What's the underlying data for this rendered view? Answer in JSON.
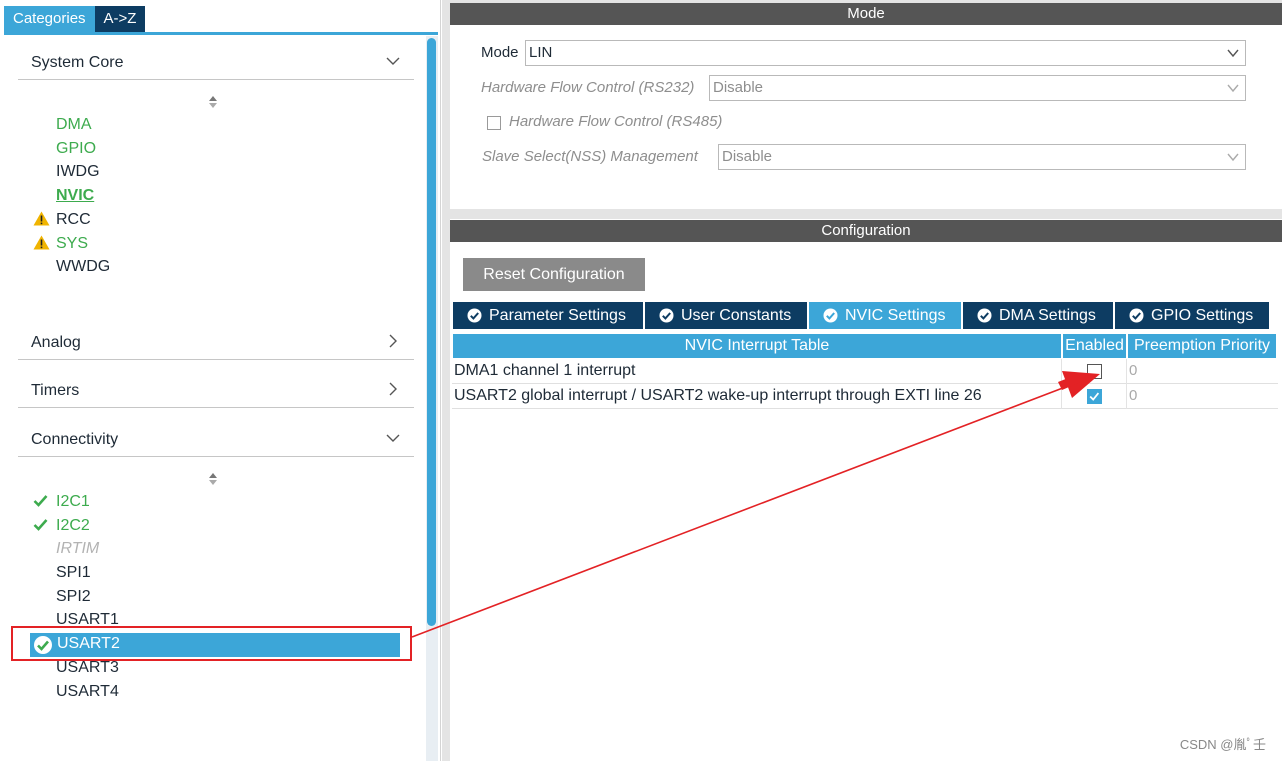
{
  "left_tabs": {
    "categories": "Categories",
    "az": "A->Z"
  },
  "system_core": {
    "label": "System Core",
    "items": [
      {
        "label": "DMA",
        "style": "green"
      },
      {
        "label": "GPIO",
        "style": "green"
      },
      {
        "label": "IWDG",
        "style": "normal"
      },
      {
        "label": "NVIC",
        "style": "bold-green"
      },
      {
        "label": "RCC",
        "style": "warning"
      },
      {
        "label": "SYS",
        "style": "warning-green"
      },
      {
        "label": "WWDG",
        "style": "normal"
      }
    ]
  },
  "analog": {
    "label": "Analog"
  },
  "timers": {
    "label": "Timers"
  },
  "connectivity": {
    "label": "Connectivity",
    "items": [
      {
        "label": "I2C1",
        "style": "check-green"
      },
      {
        "label": "I2C2",
        "style": "check-green"
      },
      {
        "label": "IRTIM",
        "style": "disabled"
      },
      {
        "label": "SPI1",
        "style": "normal"
      },
      {
        "label": "SPI2",
        "style": "normal"
      },
      {
        "label": "USART1",
        "style": "normal"
      },
      {
        "label": "USART2",
        "style": "selected"
      },
      {
        "label": "USART3",
        "style": "normal"
      },
      {
        "label": "USART4",
        "style": "normal"
      }
    ]
  },
  "mode": {
    "title": "Mode",
    "mode_label": "Mode",
    "mode_value": "LIN",
    "hw_flow_232_label": "Hardware Flow Control (RS232)",
    "hw_flow_232_value": "Disable",
    "hw_flow_485_label": "Hardware Flow Control (RS485)",
    "nss_label": "Slave Select(NSS) Management",
    "nss_value": "Disable"
  },
  "configuration": {
    "title": "Configuration",
    "reset_label": "Reset Configuration",
    "tabs": [
      {
        "label": "Parameter Settings",
        "active": false
      },
      {
        "label": "User Constants",
        "active": false
      },
      {
        "label": "NVIC Settings",
        "active": true
      },
      {
        "label": "DMA Settings",
        "active": false
      },
      {
        "label": "GPIO Settings",
        "active": false
      }
    ],
    "table": {
      "headers": [
        "NVIC Interrupt Table",
        "Enabled",
        "Preemption Priority"
      ],
      "rows": [
        {
          "name": "DMA1 channel 1 interrupt",
          "enabled": false,
          "priority": "0"
        },
        {
          "name": "USART2 global interrupt / USART2 wake-up interrupt through EXTI line 26",
          "enabled": true,
          "priority": "0"
        }
      ]
    }
  },
  "watermark": "CSDN @胤ﾟ壬",
  "colors": {
    "accent": "#3ca6d8",
    "navy": "#0d3c62",
    "annotation_red": "#e32225",
    "ok_green": "#3dab4e",
    "warning": "#f0b400"
  }
}
